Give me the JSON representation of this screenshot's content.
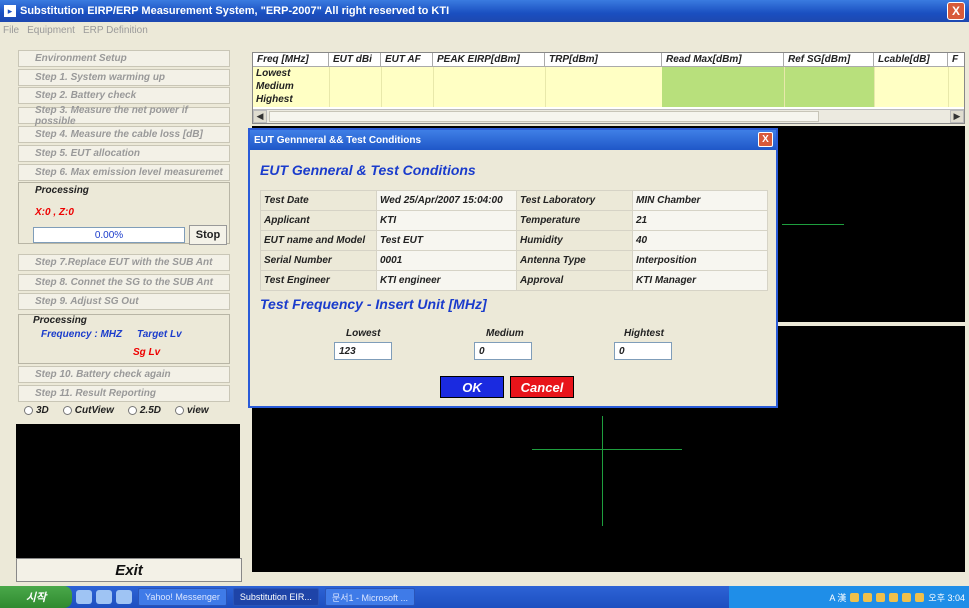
{
  "window": {
    "title": "Substitution EIRP/ERP Measurement System, \"ERP-2007\" All right reserved to KTI",
    "close": "X"
  },
  "menu": [
    "File",
    "Equipment",
    "ERP Definition"
  ],
  "steps_top": [
    "Environment Setup",
    "Step 1. System warming up",
    "Step 2. Battery check",
    "Step 3. Measure the net power if possible",
    "Step 4. Measure the cable loss [dB]",
    "Step 5. EUT allocation",
    "Step 6. Max emission level measuremet"
  ],
  "processing1": {
    "header": "Processing",
    "xz": "X:0 , Z:0",
    "progress_text": "0.00%",
    "progress": 0,
    "stop": "Stop"
  },
  "steps_mid": [
    "Step 7.Replace EUT with the SUB Ant",
    "Step 8. Connet the SG to the SUB Ant",
    "Step 9. Adjust SG Out"
  ],
  "processing2": {
    "header": "Processing",
    "frequency": "Frequency : MHZ",
    "target": "Target Lv",
    "sg": "Sg Lv"
  },
  "steps_bottom": [
    "Step 10. Battery check again",
    "Step 11. Result Reporting"
  ],
  "views": [
    "3D",
    "CutView",
    "2.5D",
    "view"
  ],
  "exit": "Exit",
  "grid": {
    "columns": [
      "Freq [MHz]",
      "EUT dBi",
      "EUT AF",
      "PEAK EIRP[dBm]",
      "TRP[dBm]",
      "Read Max[dBm]",
      "Ref SG[dBm]",
      "Lcable[dB]",
      "F"
    ],
    "rows": [
      "Lowest",
      "Medium",
      "Highest"
    ]
  },
  "dialog": {
    "title": "EUT Gennneral && Test Conditions",
    "close": "X",
    "heading": "EUT Genneral & Test Conditions",
    "rows": [
      {
        "l1": "Test Date",
        "v1": "Wed 25/Apr/2007 15:04:00",
        "l2": "Test Laboratory",
        "v2": "MIN Chamber"
      },
      {
        "l1": "Applicant",
        "v1": "KTI",
        "l2": "Temperature",
        "v2": "21"
      },
      {
        "l1": "EUT name and Model",
        "v1": "Test EUT",
        "l2": "Humidity",
        "v2": "40"
      },
      {
        "l1": "Serial Number",
        "v1": "0001",
        "l2": "Antenna Type",
        "v2": "Interposition"
      },
      {
        "l1": "Test Engineer",
        "v1": "KTI engineer",
        "l2": "Approval",
        "v2": "KTI Manager"
      }
    ],
    "freq_heading": "Test Frequency - Insert Unit [MHz]",
    "freqs": [
      {
        "label": "Lowest",
        "value": "123"
      },
      {
        "label": "Medium",
        "value": "0"
      },
      {
        "label": "Hightest",
        "value": "0"
      }
    ],
    "ok": "OK",
    "cancel": "Cancel"
  },
  "taskbar": {
    "start": "시작",
    "tasks": [
      "Yahoo! Messenger",
      "Substitution EIR...",
      "문서1 - Microsoft ..."
    ],
    "clock": "오후 3:04",
    "ime": "A 漢"
  }
}
